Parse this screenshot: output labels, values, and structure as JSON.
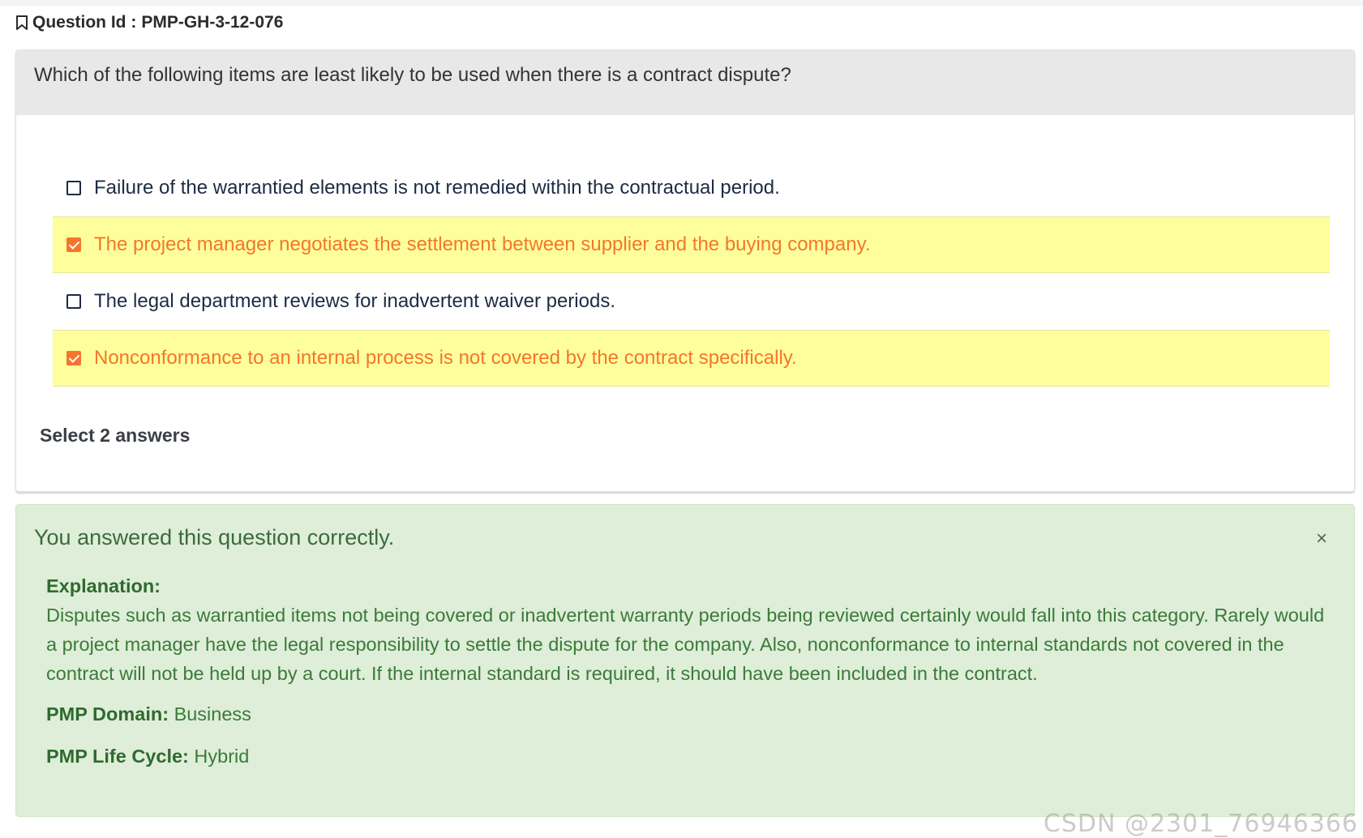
{
  "question": {
    "id_label": "Question Id :",
    "id_value": "PMP-GH-3-12-076",
    "text": "Which of the following items are least likely to be used when there is a contract dispute?",
    "options": [
      {
        "text": "Failure of the warrantied elements is not remedied within the contractual period.",
        "selected": false
      },
      {
        "text": "The project manager negotiates the settlement between supplier and the buying company.",
        "selected": true
      },
      {
        "text": "The legal department reviews for inadvertent waiver periods.",
        "selected": false
      },
      {
        "text": "Nonconformance to an internal process is not covered by the contract specifically.",
        "selected": true
      }
    ],
    "select_hint": "Select 2 answers"
  },
  "feedback": {
    "title": "You answered this question correctly.",
    "close_label": "×",
    "explanation_label": "Explanation:",
    "explanation_text": "Disputes such as warrantied items not being covered or inadvertent warranty periods being reviewed certainly would fall into this category. Rarely would a project manager have the legal responsibility to settle the dispute for the company. Also, nonconformance to internal standards not covered in the contract will not be held up by a court. If the internal standard is required, it should have been included in the contract.",
    "domain_label": "PMP Domain:",
    "domain_value": "Business",
    "lifecycle_label": "PMP Life Cycle:",
    "lifecycle_value": "Hybrid"
  },
  "watermark": "CSDN @2301_76946366",
  "colors": {
    "selected_bg": "#feff9c",
    "selected_text": "#f5762b",
    "success_bg": "#deeed8",
    "success_text": "#3b7a3a"
  },
  "icons": {
    "bookmark": "bookmark-icon",
    "checkbox_checked": "checkbox-checked-icon",
    "checkbox_unchecked": "checkbox-unchecked-icon",
    "close": "close-icon"
  }
}
